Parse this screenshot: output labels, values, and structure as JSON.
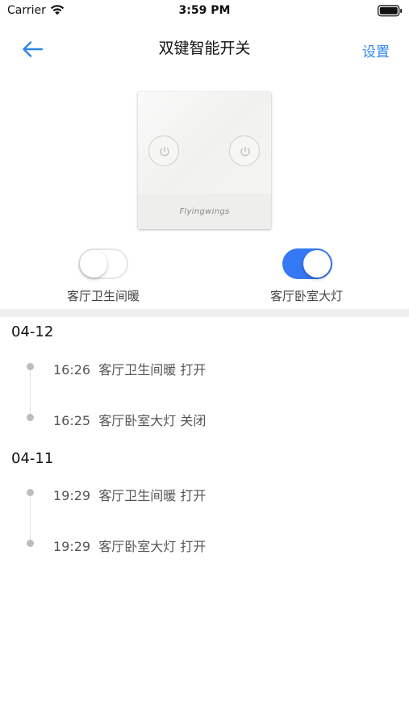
{
  "status_bar": {
    "carrier": "Carrier",
    "time": "3:59 PM"
  },
  "nav": {
    "title": "双键智能开关",
    "settings_label": "设置",
    "accent_color": "#2f86e8"
  },
  "device": {
    "brand": "Flyingwings"
  },
  "switches": [
    {
      "label": "客厅卫生间暖",
      "on": false
    },
    {
      "label": "客厅卧室大灯",
      "on": true
    }
  ],
  "log": {
    "groups": [
      {
        "date": "04-12",
        "entries": [
          {
            "time": "16:26",
            "name": "客厅卫生间暖",
            "action": "打开"
          },
          {
            "time": "16:25",
            "name": "客厅卧室大灯",
            "action": "关闭"
          }
        ]
      },
      {
        "date": "04-11",
        "entries": [
          {
            "time": "19:29",
            "name": "客厅卫生间暖",
            "action": "打开"
          },
          {
            "time": "19:29",
            "name": "客厅卧室大灯",
            "action": "打开"
          }
        ]
      }
    ]
  }
}
